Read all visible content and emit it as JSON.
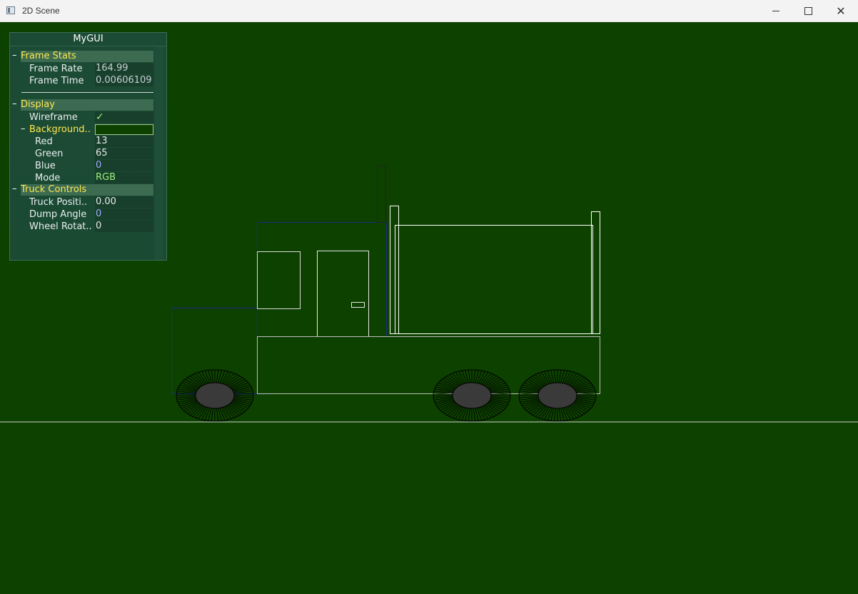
{
  "window": {
    "title": "2D Scene",
    "icon": "app-window-icon"
  },
  "gui": {
    "title": "MyGUI",
    "sections": {
      "frame_stats": {
        "label": "Frame Stats",
        "frame_rate_label": "Frame Rate",
        "frame_rate_value": "164.99",
        "frame_time_label": "Frame Time",
        "frame_time_value": "0.00606109"
      },
      "display": {
        "label": "Display",
        "wireframe_label": "Wireframe",
        "wireframe_value": "✓",
        "background_label": "Background..",
        "red_label": "Red",
        "red_value": "13",
        "green_label": "Green",
        "green_value": "65",
        "blue_label": "Blue",
        "blue_value": "0",
        "mode_label": "Mode",
        "mode_value": "RGB"
      },
      "truck_controls": {
        "label": "Truck Controls",
        "position_label": "Truck Positi..",
        "position_value": "0.00",
        "dump_label": "Dump Angle",
        "dump_value": "0",
        "wheel_label": "Wheel Rotat..",
        "wheel_value": "0"
      }
    },
    "collapse_symbol": "–"
  },
  "colors": {
    "background": "#0d4100",
    "wire": "#ffffff",
    "cab": "#1a2a8a",
    "wheel": "#3a3a3a"
  }
}
